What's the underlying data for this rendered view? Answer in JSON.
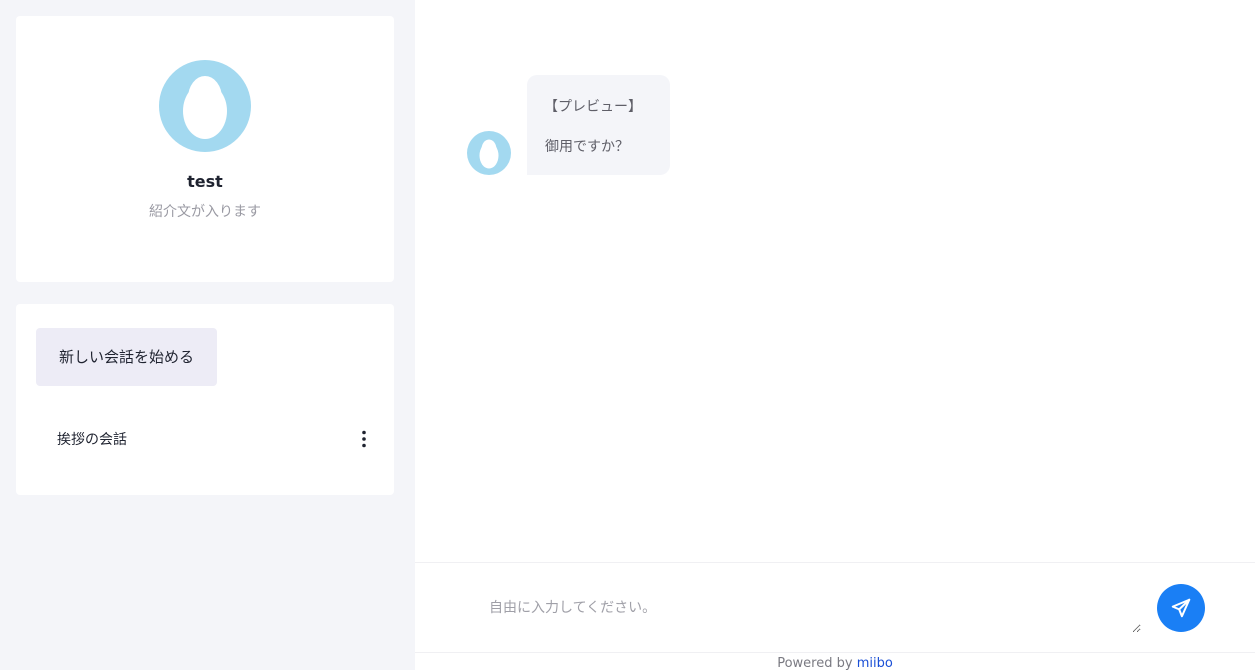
{
  "colors": {
    "accent": "#1a7ff5",
    "avatar": "#a3d9f0",
    "sidebar_bg": "#f4f5f9",
    "link": "#1a4fd6"
  },
  "profile": {
    "name": "test",
    "description": "紹介文が入ります",
    "avatar_icon": "egg-avatar-icon"
  },
  "history": {
    "new_chat_label": "新しい会話を始める",
    "conversations": [
      {
        "label": "挨拶の会話",
        "menu_icon": "more-vertical-icon"
      }
    ]
  },
  "chat": {
    "messages": [
      {
        "role": "bot",
        "lines": [
          "【プレビュー】",
          "御用ですか？"
        ]
      }
    ],
    "input_placeholder": "自由に入力してください。",
    "send_icon": "send-icon"
  },
  "footer": {
    "prefix": "Powered by",
    "brand": "miibo"
  }
}
